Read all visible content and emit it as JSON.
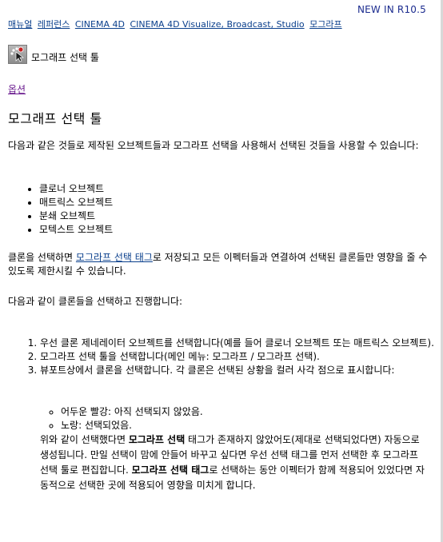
{
  "header": {
    "new_in": "NEW IN R10.5",
    "breadcrumb": [
      "매뉴얼",
      "레퍼런스",
      "CINEMA 4D",
      "CINEMA 4D Visualize, Broadcast, Studio",
      "모그라프"
    ],
    "tool_label": "모그래프 선택 툴",
    "tool_icon": "mograph-selection-icon"
  },
  "options_link": "옵션",
  "title": "모그래프 선택 툴",
  "intro": "다음과 같은 것들로 제작된 오브젝트들과 모그라프 선택을 사용해서 선택된 것들을 사용할 수 있습니다:",
  "object_list": [
    "클로너 오브젝트",
    "매트릭스 오브젝트",
    "분쇄 오브젝트",
    "모텍스트 오브젝트"
  ],
  "para2": {
    "before": "클론을 선택하면 ",
    "link": "모그라프 선택 태그",
    "after": "로 저장되고 모든 이펙터들과 연결하여 선택된 클론들만 영향을 줄 수 있도록 제한시킬 수 있습니다."
  },
  "para3": "다음과 같이 클론들을 선택하고 진행합니다:",
  "steps": [
    "우선 클론 제네레이터 오브젝트를 선택합니다(예를 들어 클로너 오브젝트 또는 매트릭스 오브젝트).",
    "모그라프 선택 툴을 선택합니다(메인 메뉴: 모그라프 / 모그라프 선택).",
    "뷰포트상에서 클론을 선택합니다. 각 클론은 선택된 상황을 컬러 사각 점으로 표시합니다:"
  ],
  "states": [
    "어두운 빨강: 아직 선택되지 않았음.",
    "노랑: 선택되었음."
  ],
  "final": {
    "t1": "위와 같이 선택했다면 ",
    "b1": "모그라프 선택",
    "t2": " 태그가 존재하지 않았어도(제대로 선택되었다면) 자동으로 생성됩니다. 만일 선택이 맘에 안들어 바꾸고 싶다면 우선 선택 태그를 먼저 선택한 후 모그라프 선택 툴로 편집합니다. ",
    "b2": "모그라프 선택 태그",
    "t3": "로 선택하는 동안 이펙터가 함께 적용되어 있었다면 자동적으로 선택한 곳에 적용되어 영향을 미치게 합니다."
  },
  "colors": {
    "link": "#0a3f8c",
    "visited_link": "#6a1b8f",
    "new_in": "#1c2c8f"
  }
}
